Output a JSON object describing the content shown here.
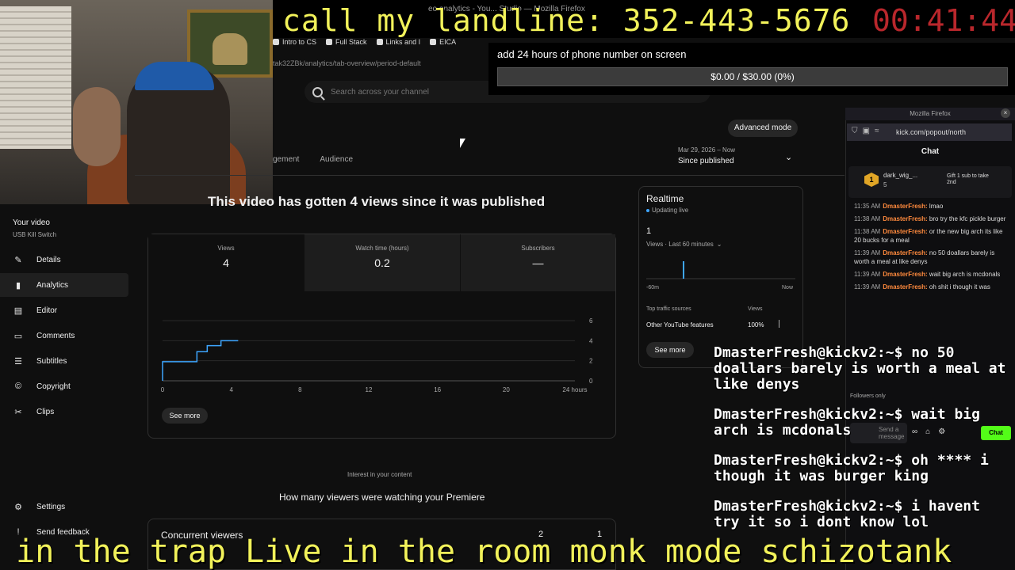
{
  "overlay": {
    "headline": "call my landline: 352-443-5676",
    "timer": "00:41:44",
    "ticker": "e in the trap Live in the room monk mode schizotank",
    "goal_title": "add 24 hours of phone number on screen",
    "goal_progress": "$0.00 / $30.00 (0%)",
    "goal_fraction": 0.0
  },
  "browser": {
    "window_title": "eo analytics - You... Studio — Mozilla Firefox",
    "bookmarks": [
      "Intro to CS",
      "Full Stack",
      "Links and I",
      "EICA"
    ],
    "url": "tak32ZBk/analytics/tab-overview/period-default"
  },
  "search": {
    "placeholder": "Search across your channel"
  },
  "nav": {
    "your_video_label": "Your video",
    "video_name": "USB Kill Switch",
    "items": [
      {
        "label": "Details",
        "icon": "pencil-icon"
      },
      {
        "label": "Analytics",
        "icon": "analytics-icon"
      },
      {
        "label": "Editor",
        "icon": "editor-icon"
      },
      {
        "label": "Comments",
        "icon": "comments-icon"
      },
      {
        "label": "Subtitles",
        "icon": "subtitles-icon"
      },
      {
        "label": "Copyright",
        "icon": "copyright-icon"
      },
      {
        "label": "Clips",
        "icon": "scissors-icon"
      }
    ],
    "settings_label": "Settings",
    "feedback_label": "Send feedback"
  },
  "content": {
    "tabs": [
      "gement",
      "Audience"
    ],
    "advanced_mode": "Advanced mode",
    "date_range": "Mar 29, 2026 – Now",
    "period": "Since published",
    "headline": "This video has gotten 4 views since it was published",
    "metrics": [
      {
        "label": "Views",
        "value": "4"
      },
      {
        "label": "Watch time (hours)",
        "value": "0.2"
      },
      {
        "label": "Subscribers",
        "value": "—"
      }
    ],
    "see_more": "See more",
    "interest": "Interest in your content",
    "premiere_question": "How many viewers were watching your Premiere",
    "concurrent_label": "Concurrent viewers",
    "concurrent_col_a": "2",
    "concurrent_col_b": "1"
  },
  "chart_data": {
    "type": "line",
    "x_ticks": [
      "0",
      "4",
      "8",
      "12",
      "16",
      "20",
      "24 hours"
    ],
    "y_ticks": [
      "0",
      "2",
      "4",
      "6"
    ],
    "ylim": [
      0,
      6
    ],
    "xlim": [
      0,
      24
    ],
    "series": [
      {
        "x": [
          0,
          0,
          2,
          2,
          2.6,
          2.6,
          3.4,
          3.4,
          4.4
        ],
        "y": [
          0,
          1.9,
          1.9,
          2.9,
          2.9,
          3.5,
          3.5,
          4,
          4
        ]
      }
    ]
  },
  "realtime": {
    "title": "Realtime",
    "updating": "Updating live",
    "count": "1",
    "subtitle": "Views · Last 60 minutes",
    "axis_start": "-60m",
    "axis_end": "Now",
    "sources_label": "Top traffic sources",
    "views_label": "Views",
    "source_name": "Other YouTube features",
    "source_pct": "100%",
    "see_more": "See more"
  },
  "chat": {
    "window_title": "Mozilla Firefox",
    "url": "kick.com/popout/north",
    "header": "Chat",
    "pinned_user": "dark_wig_...",
    "pinned_count": "5",
    "gift_text": "Gift 1 sub to take 2nd",
    "messages": [
      {
        "time": "11:35 AM",
        "user": "DmasterFresh:",
        "text": "lmao"
      },
      {
        "time": "11:38 AM",
        "user": "DmasterFresh:",
        "text": "bro try the kfc pickle burger"
      },
      {
        "time": "11:38 AM",
        "user": "DmasterFresh:",
        "text": "or the new big arch its like 20 bucks for a meal"
      },
      {
        "time": "11:39 AM",
        "user": "DmasterFresh:",
        "text": "no 50 doallars barely is worth a meal at like denys"
      },
      {
        "time": "11:39 AM",
        "user": "DmasterFresh:",
        "text": "wait big arch is mcdonals"
      },
      {
        "time": "11:39 AM",
        "user": "DmasterFresh:",
        "text": "oh shit i though it was"
      }
    ],
    "followers_only": "Followers only",
    "input_placeholder": "Send a message",
    "chat_button": "Chat"
  },
  "terminal": [
    {
      "prompt": "DmasterFresh@kickv2:~$",
      "text": " no 50 doallars barely is worth a meal at like denys"
    },
    {
      "prompt": "DmasterFresh@kickv2:~$",
      "text": " wait big arch is mcdonals"
    },
    {
      "prompt": "DmasterFresh@kickv2:~$",
      "text": " oh **** i though it was burger king"
    },
    {
      "prompt": "DmasterFresh@kickv2:~$",
      "text": " i havent try it so i dont know lol"
    }
  ]
}
